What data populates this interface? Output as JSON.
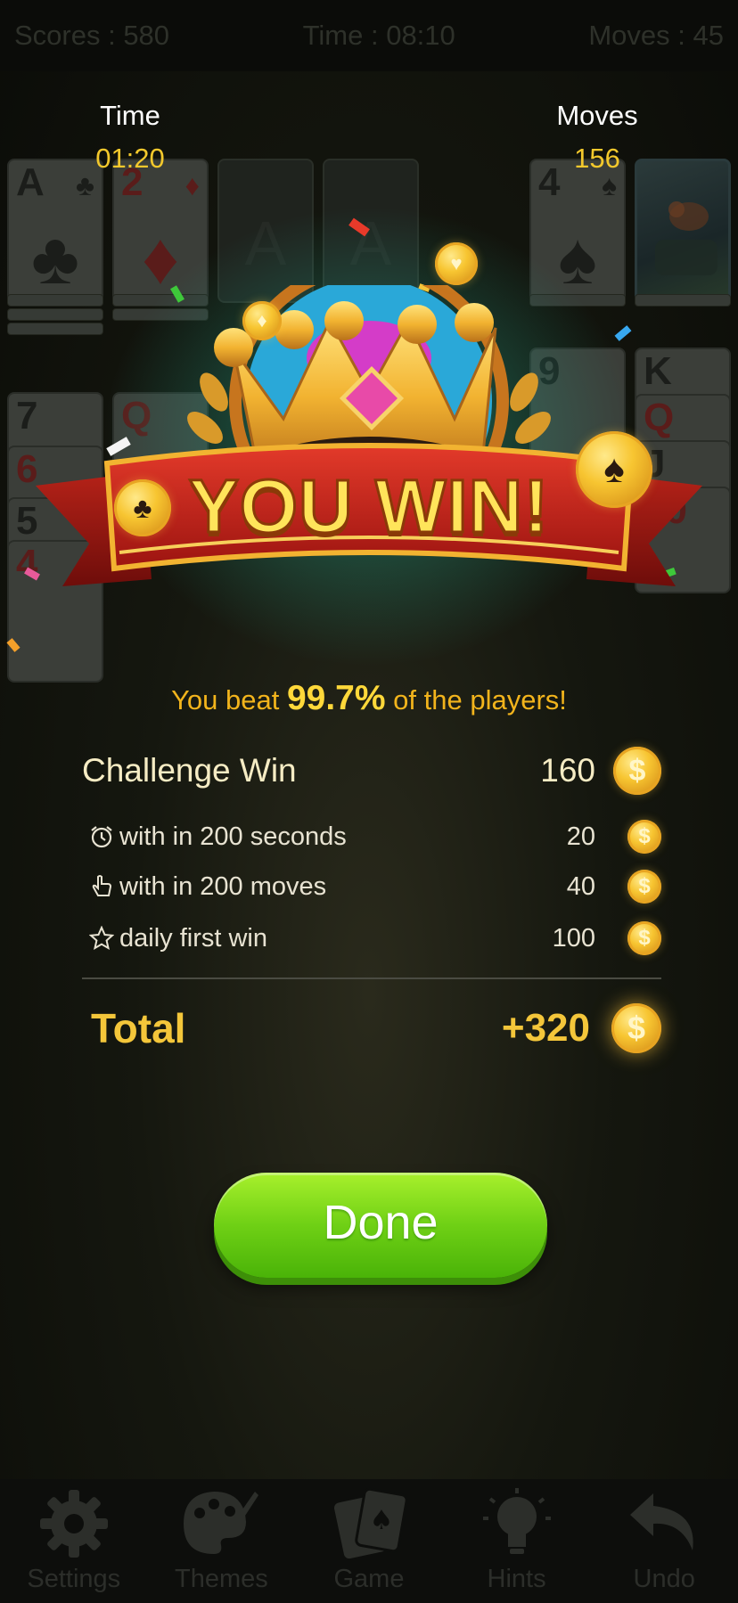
{
  "top_bar": {
    "scores": "Scores : 580",
    "time": "Time : 08:10",
    "moves": "Moves : 45"
  },
  "header": {
    "time_label": "Time",
    "time_value": "01:20",
    "moves_label": "Moves",
    "moves_value": "156"
  },
  "board": {
    "cards": [
      {
        "rank": "A",
        "suit": "♣",
        "color": "black"
      },
      {
        "rank": "2",
        "suit": "♦",
        "color": "red"
      },
      {
        "rank": "A",
        "suit": "",
        "color": "empty"
      },
      {
        "rank": "A",
        "suit": "",
        "color": "empty"
      },
      {
        "rank": "4",
        "suit": "♠",
        "color": "black"
      }
    ],
    "column_cards": [
      "7",
      "6",
      "5",
      "4",
      "Q",
      "9",
      "K",
      "Q",
      "J",
      "10"
    ]
  },
  "banner": {
    "text": "YOU WIN!"
  },
  "beat": {
    "prefix": "You beat ",
    "percent": "99.7%",
    "suffix": " of the players!"
  },
  "rewards": {
    "main": {
      "label": "Challenge Win",
      "value": "160"
    },
    "items": [
      {
        "label": "with in 200 seconds",
        "value": "20",
        "icon": "alarm-clock-icon"
      },
      {
        "label": "with in 200 moves",
        "value": "40",
        "icon": "hand-pointer-icon"
      },
      {
        "label": "daily first win",
        "value": "100",
        "icon": "star-icon"
      }
    ],
    "total_label": "Total",
    "total_value": "+320",
    "coin_symbol": "$"
  },
  "done_button": "Done",
  "nav": [
    {
      "label": "Settings",
      "icon": "gear-icon"
    },
    {
      "label": "Themes",
      "icon": "palette-icon"
    },
    {
      "label": "Game",
      "icon": "cards-icon"
    },
    {
      "label": "Hints",
      "icon": "lightbulb-icon"
    },
    {
      "label": "Undo",
      "icon": "undo-icon"
    }
  ],
  "colors": {
    "accent_gold": "#f4c63a",
    "button_green": "#6fd015",
    "banner_red": "#c0201c"
  }
}
